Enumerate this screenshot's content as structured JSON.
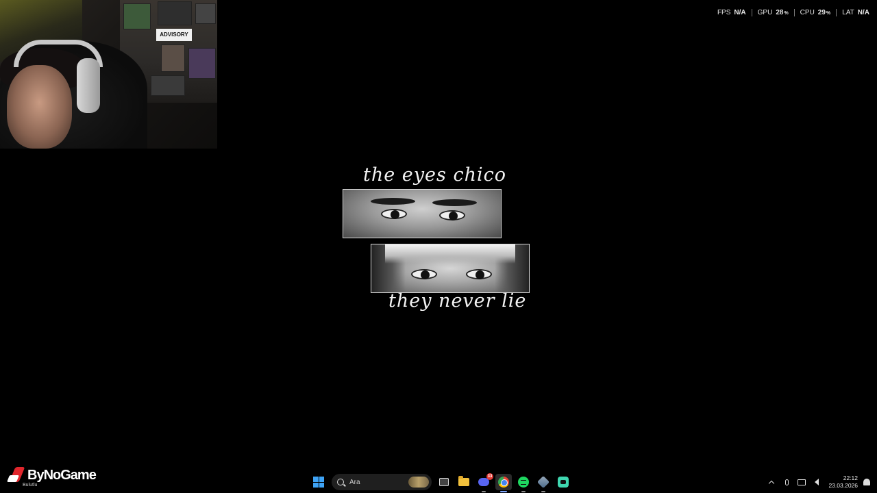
{
  "perf_overlay": {
    "items": [
      {
        "label": "FPS",
        "value": "N/A",
        "unit": ""
      },
      {
        "label": "GPU",
        "value": "28",
        "unit": "%"
      },
      {
        "label": "CPU",
        "value": "29",
        "unit": "%"
      },
      {
        "label": "LAT",
        "value": "N/A",
        "unit": ""
      }
    ]
  },
  "webcam": {
    "poster_text": "ADVISORY"
  },
  "wallpaper": {
    "top_text": "the eyes chico",
    "bottom_text": "they never lie"
  },
  "brand": {
    "name": "ByNoGame",
    "sub": "Bulutlu"
  },
  "taskbar": {
    "search_placeholder": "Ara",
    "discord_badge": "33",
    "apps": [
      "start-icon",
      "task-view-icon",
      "file-explorer-icon",
      "discord-icon",
      "chrome-icon",
      "spotify-icon",
      "app-icon",
      "chat-icon"
    ]
  },
  "tray": {
    "time": "22:12",
    "date": "23.03.2026"
  }
}
